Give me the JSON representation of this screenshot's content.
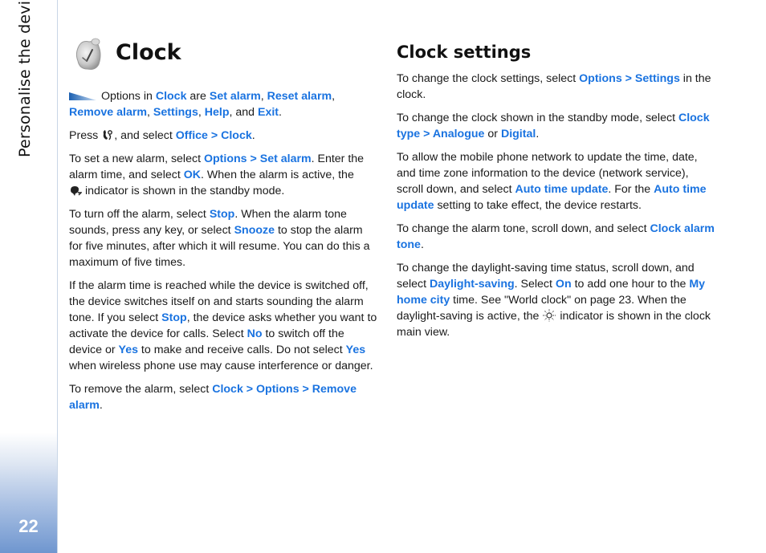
{
  "sidebar": {
    "section_title": "Personalise the device",
    "page_number": "22"
  },
  "colors": {
    "link": "#1a73e0",
    "sidebar_gradient_bottom": "#6f96cf"
  },
  "left": {
    "title": "Clock",
    "icon": "alarm-clock-icon",
    "p1": {
      "t1": "Options in ",
      "l1": "Clock",
      "t2": " are ",
      "l2": "Set alarm",
      "t3": ", ",
      "l3": "Reset alarm",
      "t4": ", ",
      "l4": "Remove alarm",
      "t5": ", ",
      "l5": "Settings",
      "t6": ", ",
      "l6": "Help",
      "t7": ", and ",
      "l7": "Exit",
      "t8": "."
    },
    "p2": {
      "t1": "Press ",
      "icon": "menu-key-icon",
      "t2": ", and select ",
      "l1": "Office > Clock",
      "t3": "."
    },
    "p3": {
      "t1": "To set a new alarm, select ",
      "l1": "Options > Set alarm",
      "t2": ". Enter the alarm time, and select ",
      "l2": "OK",
      "t3": ". When the alarm is active, the ",
      "icon": "alarm-indicator-icon",
      "t4": " indicator is shown in the standby mode."
    },
    "p4": {
      "t1": "To turn off the alarm, select ",
      "l1": "Stop",
      "t2": ". When the alarm tone sounds, press any key, or select ",
      "l2": "Snooze",
      "t3": " to stop the alarm for five minutes, after which it will resume. You can do this a maximum of five times."
    },
    "p5": {
      "t1": "If the alarm time is reached while the device is switched off, the device switches itself on and starts sounding the alarm tone. If you select ",
      "l1": "Stop",
      "t2": ", the device asks whether you want to activate the device for calls. Select ",
      "l2": "No",
      "t3": " to switch off the device or ",
      "l3": "Yes",
      "t4": " to make and receive calls. Do not select ",
      "l4": "Yes",
      "t5": " when wireless phone use may cause interference or danger."
    },
    "p6": {
      "t1": "To remove the alarm, select ",
      "l1": "Clock > Options > Remove alarm",
      "t2": "."
    }
  },
  "right": {
    "heading": "Clock settings",
    "p1": {
      "t1": "To change the clock settings, select ",
      "l1": "Options > Settings",
      "t2": " in the clock."
    },
    "p2": {
      "t1": "To change the clock shown in the standby mode, select ",
      "l1": "Clock type > Analogue",
      "t2": " or ",
      "l2": "Digital",
      "t3": "."
    },
    "p3": {
      "t1": "To allow the mobile phone network to update the time, date, and time zone information to the device (network service), scroll down, and select ",
      "l1": "Auto time update",
      "t2": ". For the ",
      "l2": "Auto time update",
      "t3": " setting to take effect, the device restarts."
    },
    "p4": {
      "t1": "To change the alarm tone, scroll down, and select ",
      "l1": "Clock alarm tone",
      "t2": "."
    },
    "p5": {
      "t1": "To change the daylight-saving time status, scroll down, and select ",
      "l1": "Daylight-saving",
      "t2": ". Select ",
      "l2": "On",
      "t3": " to add one hour to the ",
      "l3": "My home city",
      "t4": " time. See \"World clock\" on page 23. When the daylight-saving is active, the ",
      "icon": "daylight-saving-sun-icon",
      "t5": " indicator is shown in the clock main view."
    }
  }
}
